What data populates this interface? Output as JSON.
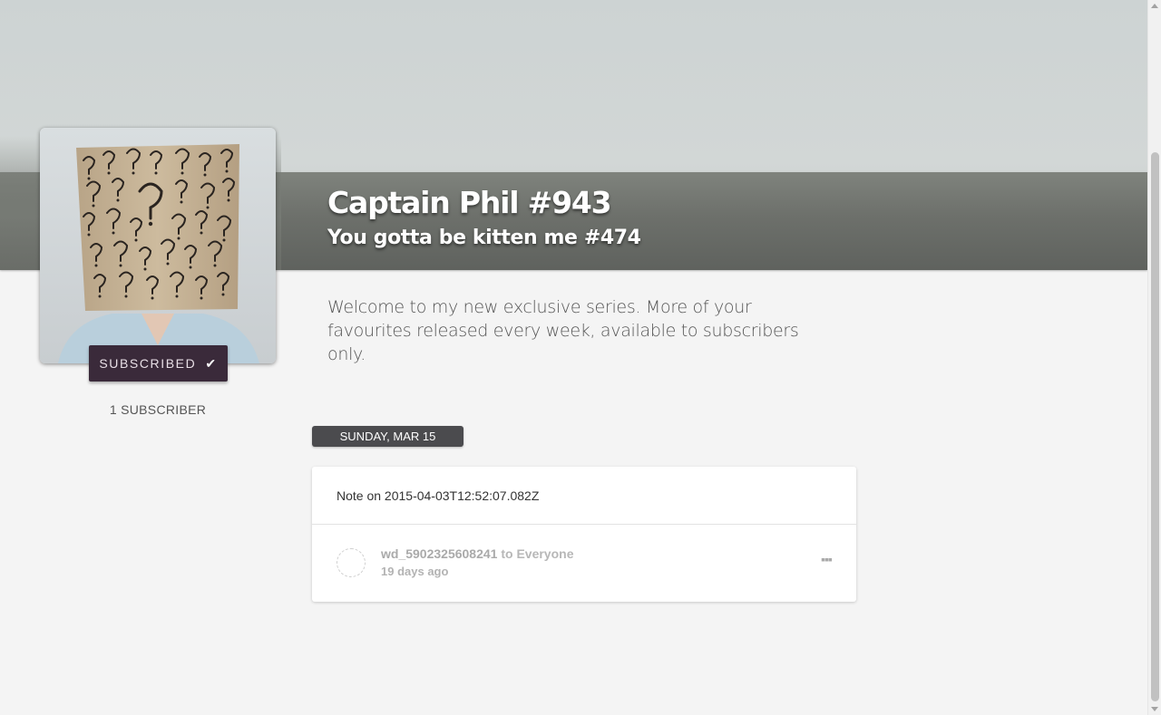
{
  "series": {
    "title": "Captain Phil #943",
    "subtitle": "You gotta be kitten me #474",
    "description": "Welcome to my new exclusive series. More of your favourites released every week, available to subscribers only."
  },
  "subscribe": {
    "label": "SUBSCRIBED",
    "icon": "check-icon",
    "subscriber_count": "1 SUBSCRIBER"
  },
  "feed": {
    "date_label": "SUNDAY, MAR 15",
    "note": {
      "title": "Note on 2015-04-03T12:52:07.082Z",
      "author": "wd_5902325608241",
      "audience": "to Everyone",
      "time_ago": "19 days ago",
      "menu_icon": "more-icon"
    }
  },
  "colors": {
    "subscribe_button": "#3a2a3a",
    "date_badge": "#4b4b4e",
    "hero_band": "#6d706b"
  }
}
